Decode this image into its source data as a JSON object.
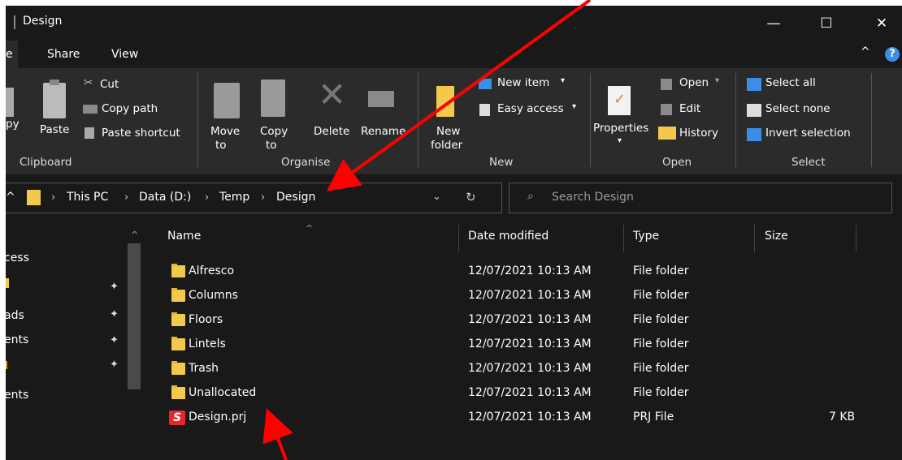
{
  "window": {
    "title": "Design",
    "controls": {
      "minimize": "—",
      "maximize": "☐",
      "close": "✕"
    }
  },
  "tabs": [
    {
      "label": "e"
    },
    {
      "label": "Share"
    },
    {
      "label": "View"
    }
  ],
  "ribbon": {
    "clipboard": {
      "copy_label": "py",
      "paste_label": "Paste",
      "cut_label": "Cut",
      "copy_path_label": "Copy path",
      "paste_shortcut_label": "Paste shortcut",
      "group_label": "Clipboard"
    },
    "organise": {
      "move_label": "Move",
      "move_to_label": "to",
      "copy_label": "Copy",
      "copy_to_label": "to",
      "delete_label": "Delete",
      "rename_label": "Rename",
      "group_label": "Organise"
    },
    "new": {
      "new_folder_line1": "New",
      "new_folder_line2": "folder",
      "new_item_label": "New item",
      "easy_access_label": "Easy access",
      "group_label": "New"
    },
    "open": {
      "properties_label": "Properties",
      "open_label": "Open",
      "edit_label": "Edit",
      "history_label": "History",
      "group_label": "Open"
    },
    "select": {
      "select_all_label": "Select all",
      "select_none_label": "Select none",
      "invert_label": "Invert selection",
      "group_label": "Select"
    }
  },
  "address": {
    "crumbs": [
      "This PC",
      "Data (D:)",
      "Temp",
      "Design"
    ],
    "search_placeholder": "Search Design"
  },
  "nav": {
    "items": [
      "cess",
      "",
      "ads",
      "ents",
      "",
      "ents"
    ]
  },
  "columns": {
    "name": "Name",
    "date": "Date modified",
    "type": "Type",
    "size": "Size"
  },
  "files": [
    {
      "name": "Alfresco",
      "date": "12/07/2021 10:13 AM",
      "type": "File folder",
      "size": ""
    },
    {
      "name": "Columns",
      "date": "12/07/2021 10:13 AM",
      "type": "File folder",
      "size": ""
    },
    {
      "name": "Floors",
      "date": "12/07/2021 10:13 AM",
      "type": "File folder",
      "size": ""
    },
    {
      "name": "Lintels",
      "date": "12/07/2021 10:13 AM",
      "type": "File folder",
      "size": ""
    },
    {
      "name": "Trash",
      "date": "12/07/2021 10:13 AM",
      "type": "File folder",
      "size": ""
    },
    {
      "name": "Unallocated",
      "date": "12/07/2021 10:13 AM",
      "type": "File folder",
      "size": ""
    },
    {
      "name": "Design.prj",
      "date": "12/07/2021 10:13 AM",
      "type": "PRJ File",
      "size": "7 KB"
    }
  ],
  "prj_icon_glyph": "S",
  "colors": {
    "background": "#191919",
    "ribbon": "#2b2b2b",
    "folder": "#f3c94b",
    "accent_blue": "#3b8ee8",
    "annotation_arrow": "#ff0000"
  }
}
